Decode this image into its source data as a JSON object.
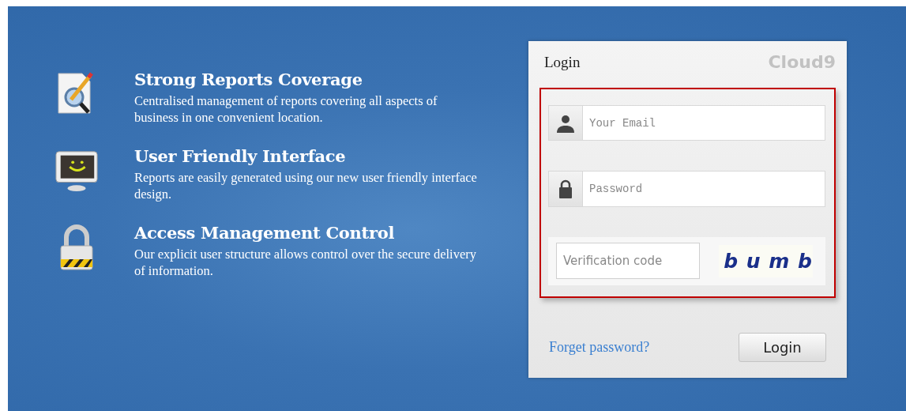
{
  "features": [
    {
      "kind": "report",
      "title": "Strong Reports Coverage",
      "description": "Centralised management of reports covering all aspects of business in one convenient location."
    },
    {
      "kind": "monitor",
      "title": "User Friendly Interface",
      "description": "Reports are easily generated using our new user friendly interface design."
    },
    {
      "kind": "lock",
      "title": "Access Management Control",
      "description": "Our explicit user structure allows control over the secure delivery of information."
    }
  ],
  "login": {
    "title": "Login",
    "brand": "Cloud9",
    "fields": [
      {
        "kind": "user",
        "placeholder": "Your Email"
      },
      {
        "kind": "password",
        "placeholder": "Password"
      }
    ],
    "verification": {
      "placeholder": "Verification code",
      "captcha": "b u m b"
    },
    "forgot_link": "Forget password?",
    "submit": "Login"
  }
}
